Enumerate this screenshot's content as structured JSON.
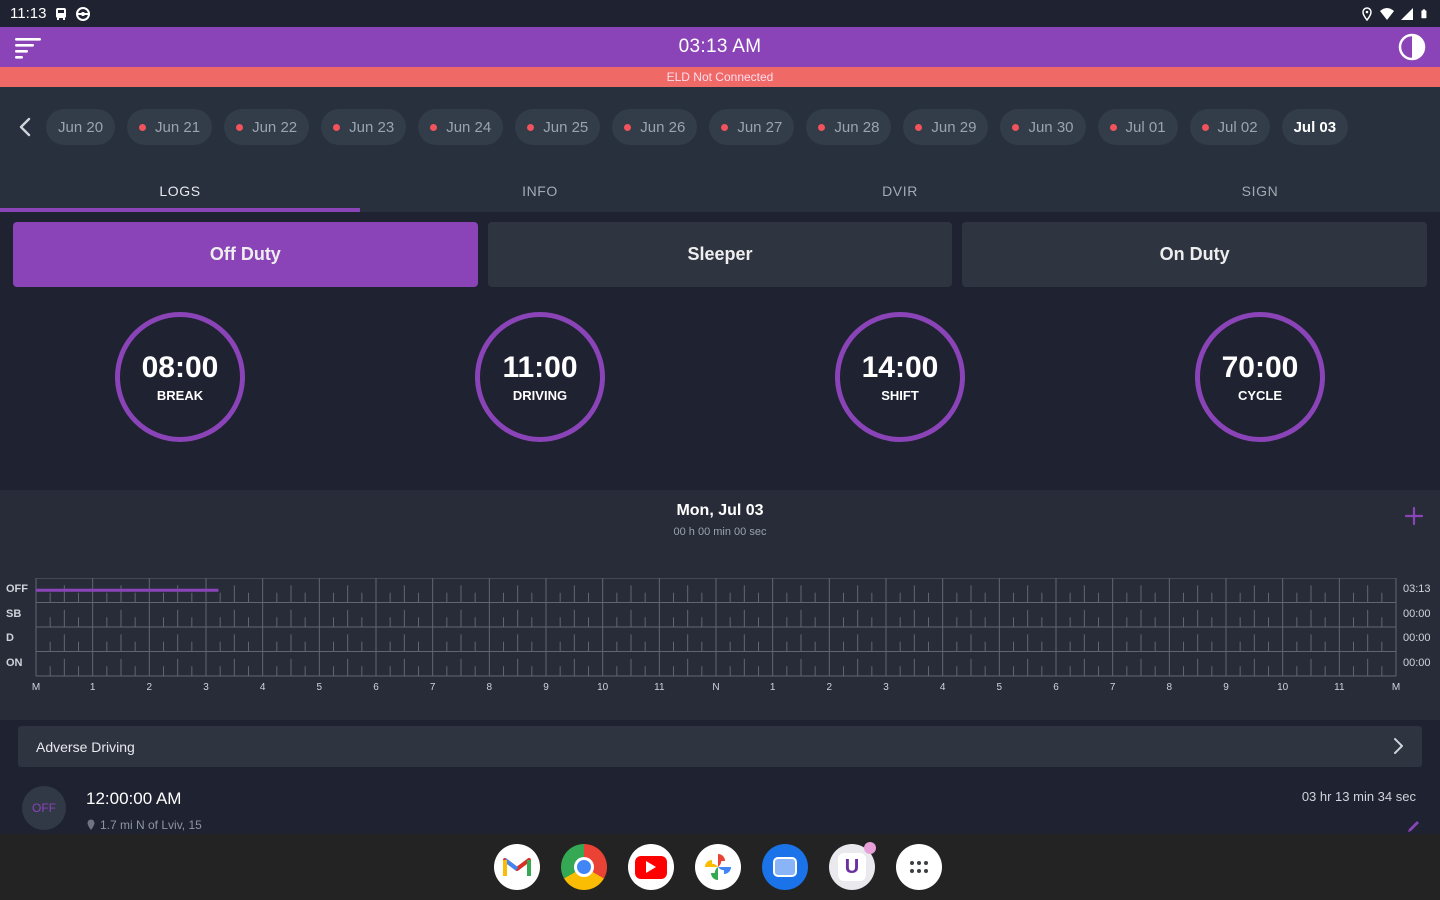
{
  "status_bar": {
    "time": "11:13",
    "left_icons": [
      "train-icon",
      "steering-wheel-icon"
    ],
    "right_icons": [
      "location-icon",
      "wifi-icon",
      "signal-icon",
      "battery-icon"
    ]
  },
  "top_bar": {
    "title": "03:13 AM",
    "menu_icon": "menu-icon",
    "theme_icon": "contrast-icon",
    "color": "#8a44b8"
  },
  "eld_banner": {
    "text": "ELD Not Connected",
    "color": "#ef6a66"
  },
  "dates": [
    {
      "label": "Jun 20",
      "has_violation": false,
      "active": false
    },
    {
      "label": "Jun 21",
      "has_violation": true,
      "active": false
    },
    {
      "label": "Jun 22",
      "has_violation": true,
      "active": false
    },
    {
      "label": "Jun 23",
      "has_violation": true,
      "active": false
    },
    {
      "label": "Jun 24",
      "has_violation": true,
      "active": false
    },
    {
      "label": "Jun 25",
      "has_violation": true,
      "active": false
    },
    {
      "label": "Jun 26",
      "has_violation": true,
      "active": false
    },
    {
      "label": "Jun 27",
      "has_violation": true,
      "active": false
    },
    {
      "label": "Jun 28",
      "has_violation": true,
      "active": false
    },
    {
      "label": "Jun 29",
      "has_violation": true,
      "active": false
    },
    {
      "label": "Jun 30",
      "has_violation": true,
      "active": false
    },
    {
      "label": "Jul 01",
      "has_violation": true,
      "active": false
    },
    {
      "label": "Jul 02",
      "has_violation": true,
      "active": false
    },
    {
      "label": "Jul 03",
      "has_violation": false,
      "active": true
    }
  ],
  "tabs": [
    {
      "label": "LOGS",
      "active": true
    },
    {
      "label": "INFO",
      "active": false
    },
    {
      "label": "DVIR",
      "active": false
    },
    {
      "label": "SIGN",
      "active": false
    }
  ],
  "duty_buttons": [
    {
      "label": "Off Duty",
      "active": true
    },
    {
      "label": "Sleeper",
      "active": false
    },
    {
      "label": "On Duty",
      "active": false
    }
  ],
  "clocks": [
    {
      "value": "08:00",
      "label": "BREAK"
    },
    {
      "value": "11:00",
      "label": "DRIVING"
    },
    {
      "value": "14:00",
      "label": "SHIFT"
    },
    {
      "value": "70:00",
      "label": "CYCLE"
    }
  ],
  "log": {
    "day": "Mon, Jul 03",
    "duration": "00 h 00 min 00 sec",
    "rows": [
      "OFF",
      "SB",
      "D",
      "ON"
    ],
    "totals": [
      "03:13",
      "00:00",
      "00:00",
      "00:00"
    ],
    "hour_labels": [
      "M",
      "1",
      "2",
      "3",
      "4",
      "5",
      "6",
      "7",
      "8",
      "9",
      "10",
      "11",
      "N",
      "1",
      "2",
      "3",
      "4",
      "5",
      "6",
      "7",
      "8",
      "9",
      "10",
      "11",
      "M"
    ],
    "segments": [
      {
        "row": 0,
        "start_hour": 0,
        "end_hour": 3.22
      }
    ],
    "line_color": "#8a44b8"
  },
  "adverse": {
    "label": "Adverse Driving"
  },
  "events": [
    {
      "badge": "OFF",
      "time": "12:00:00 AM",
      "location": "1.7 mi N of Lviv, 15",
      "duration": "03 hr 13 min 34 sec"
    }
  ],
  "dock_apps": [
    "gmail-icon",
    "chrome-icon",
    "youtube-icon",
    "photos-icon",
    "messages-icon",
    "eld-app-icon",
    "app-drawer-icon"
  ]
}
